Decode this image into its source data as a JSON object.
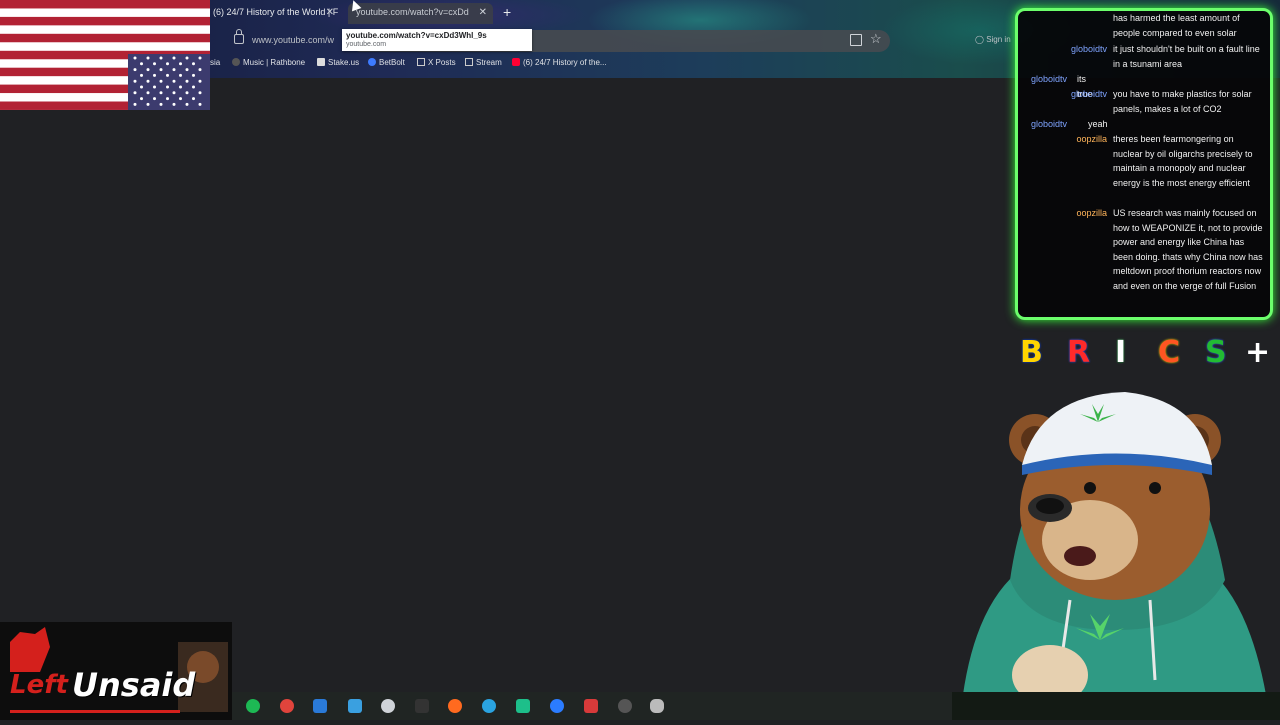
{
  "browser": {
    "tabs": [
      {
        "title": "(6) 24/7 History of the World | F",
        "active": false
      },
      {
        "title": "youtube.com/watch?v=cxDd",
        "active": true
      }
    ],
    "address_url": "www.youtube.com/w",
    "sign_in": "Sign in",
    "tooltip": {
      "url": "youtube.com/watch?v=cxDd3Whl_9s",
      "domain": "youtube.com"
    },
    "bookmarks": [
      {
        "label": "sia",
        "icon": ""
      },
      {
        "label": "Music | Rathbone",
        "icon": "music-icon"
      },
      {
        "label": "Stake.us",
        "icon": "stake-icon"
      },
      {
        "label": "BetBolt",
        "icon": "bolt-icon"
      },
      {
        "label": "X Posts",
        "icon": "folder-icon"
      },
      {
        "label": "Stream",
        "icon": "folder-icon"
      },
      {
        "label": "(6) 24/7 History of the...",
        "icon": "youtube-icon"
      }
    ]
  },
  "chat": {
    "messages": [
      {
        "user": "",
        "text": "has harmed the least amount of people compared to even solar"
      },
      {
        "user": "globoidtv",
        "text": "it just shouldn't be built on a fault line in a tsunami area"
      },
      {
        "user": "globoidtv",
        "text": "its true"
      },
      {
        "user": "globoidtv",
        "text": "you have to make plastics for solar panels, makes a lot of CO2"
      },
      {
        "user": "globoidtv",
        "text": "yeah"
      },
      {
        "user": "oopzilla",
        "text": "theres been fearmongering on nuclear by oil oligarchs precisely to maintain a monopoly and nuclear energy is the most energy efficient"
      },
      {
        "user": "oopzilla",
        "text": "US research was mainly focused on how to WEAPONIZE it, not to provide power and energy like China has been doing. thats why China now has meltdown proof thorium reactors now and even on the verge of full Fusion"
      }
    ]
  },
  "overlay_letters": [
    "B",
    "R",
    "I",
    "C",
    "S",
    "+"
  ],
  "logo": {
    "left": "Left",
    "right": "Unsaid"
  },
  "colors": {
    "chat_border": "#6cff6c",
    "user_globoid": "#7fa4ff",
    "user_oopzilla": "#ffb45a",
    "logo_red": "#d4201c"
  }
}
